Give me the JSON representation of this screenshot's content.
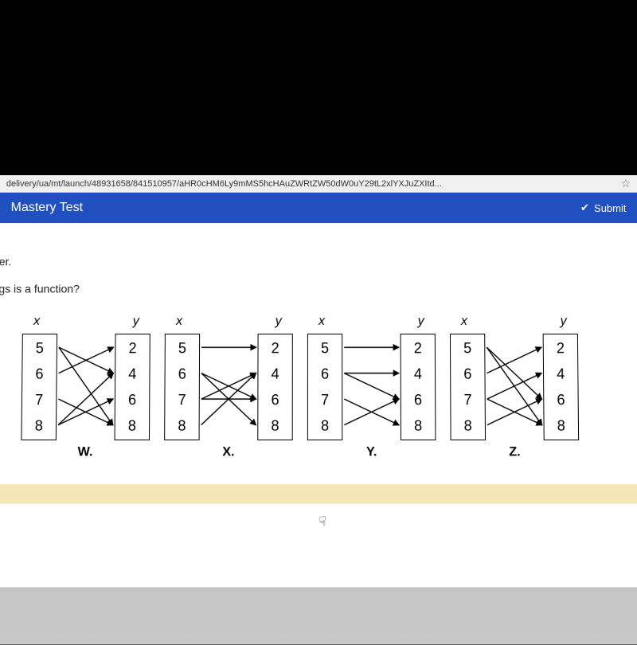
{
  "url": "delivery/ua/mt/launch/48931658/841510957/aHR0cHM6Ly9mMS5hcHAuZWRtZW50dW0uY29tL2xlYXJuZXItd...",
  "header": {
    "title": "Mastery Test",
    "submit": "Submit"
  },
  "instr": {
    "line1": "er.",
    "line2": "gs is a function?"
  },
  "axis": {
    "x": "x",
    "y": "y"
  },
  "xvals": [
    "5",
    "6",
    "7",
    "8"
  ],
  "yvals": [
    "2",
    "4",
    "6",
    "8"
  ],
  "labels": {
    "w": "W.",
    "x": "X.",
    "y": "Y.",
    "z": "Z."
  },
  "mappings": {
    "W": [
      [
        0,
        1
      ],
      [
        0,
        3
      ],
      [
        1,
        0
      ],
      [
        2,
        3
      ],
      [
        3,
        1
      ],
      [
        3,
        2
      ]
    ],
    "X": [
      [
        0,
        0
      ],
      [
        1,
        2
      ],
      [
        1,
        3
      ],
      [
        2,
        1
      ],
      [
        2,
        2
      ],
      [
        3,
        1
      ]
    ],
    "Y": [
      [
        0,
        0
      ],
      [
        1,
        1
      ],
      [
        1,
        2
      ],
      [
        2,
        3
      ],
      [
        3,
        2
      ]
    ],
    "Z": [
      [
        0,
        2
      ],
      [
        0,
        3
      ],
      [
        1,
        0
      ],
      [
        2,
        1
      ],
      [
        2,
        3
      ],
      [
        3,
        2
      ]
    ]
  },
  "chart_data": {
    "type": "table",
    "title": "Which of the following mappings is a function?",
    "maps": [
      {
        "name": "W",
        "pairs": [
          [
            5,
            4
          ],
          [
            5,
            8
          ],
          [
            6,
            2
          ],
          [
            7,
            8
          ],
          [
            8,
            4
          ],
          [
            8,
            6
          ]
        ]
      },
      {
        "name": "X",
        "pairs": [
          [
            5,
            2
          ],
          [
            6,
            6
          ],
          [
            6,
            8
          ],
          [
            7,
            4
          ],
          [
            7,
            6
          ],
          [
            8,
            4
          ]
        ]
      },
      {
        "name": "Y",
        "pairs": [
          [
            5,
            2
          ],
          [
            6,
            4
          ],
          [
            6,
            6
          ],
          [
            7,
            8
          ],
          [
            8,
            6
          ]
        ]
      },
      {
        "name": "Z",
        "pairs": [
          [
            5,
            6
          ],
          [
            5,
            8
          ],
          [
            6,
            2
          ],
          [
            7,
            4
          ],
          [
            7,
            8
          ],
          [
            8,
            6
          ]
        ]
      }
    ]
  }
}
